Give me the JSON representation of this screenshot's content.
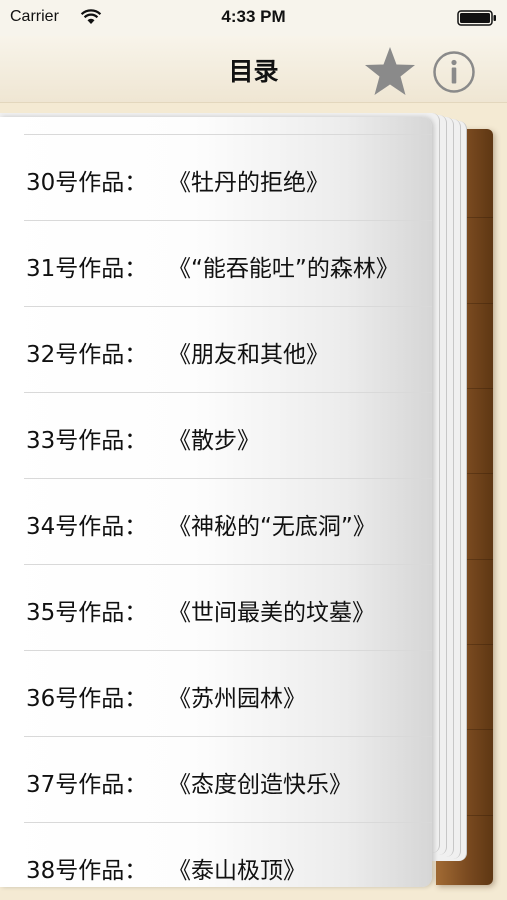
{
  "status_bar": {
    "carrier": "Carrier",
    "time": "4:33 PM"
  },
  "nav": {
    "title": "目录",
    "star_icon": "star-icon",
    "info_icon": "info-icon"
  },
  "toc": {
    "items": [
      {
        "number": "30号作品：",
        "title": "《牡丹的拒绝》"
      },
      {
        "number": "31号作品：",
        "title": "《“能吞能吐”的森林》"
      },
      {
        "number": "32号作品：",
        "title": "《朋友和其他》"
      },
      {
        "number": "33号作品：",
        "title": "《散步》"
      },
      {
        "number": "34号作品：",
        "title": "《神秘的“无底洞”》"
      },
      {
        "number": "35号作品：",
        "title": "《世间最美的坟墓》"
      },
      {
        "number": "36号作品：",
        "title": "《苏州园林》"
      },
      {
        "number": "37号作品：",
        "title": "《态度创造快乐》"
      },
      {
        "number": "38号作品：",
        "title": "《泰山极顶》"
      }
    ]
  },
  "colors": {
    "star": "#8a8a8a",
    "cover": "#7a4a20"
  }
}
